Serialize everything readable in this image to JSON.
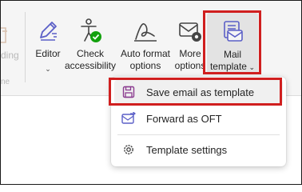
{
  "ribbon": {
    "partial_left_label": "ding",
    "partial_left_sub": "ne",
    "buttons": [
      {
        "label_line1": "Editor",
        "label_line2": "",
        "has_dropdown": true,
        "icon": "editor-pen-icon"
      },
      {
        "label_line1": "Check",
        "label_line2": "accessibility",
        "has_dropdown": false,
        "icon": "accessibility-check-icon"
      },
      {
        "label_line1": "Auto format",
        "label_line2": "options",
        "has_dropdown": false,
        "icon": "auto-format-icon"
      },
      {
        "label_line1": "More",
        "label_line2": "options",
        "has_dropdown": false,
        "icon": "mail-settings-icon"
      },
      {
        "label_line1": "Mail",
        "label_line2": "template",
        "has_dropdown": true,
        "icon": "mail-template-icon"
      }
    ]
  },
  "menu": {
    "items": [
      {
        "label": "Save email as template",
        "icon": "save-icon",
        "highlighted": true
      },
      {
        "label": "Forward as OFT",
        "icon": "forward-mail-icon",
        "highlighted": false
      },
      {
        "label": "Template settings",
        "icon": "gear-icon",
        "highlighted": false
      }
    ]
  },
  "colors": {
    "accent": "#5b5fc7",
    "highlight_box": "#d01f1f",
    "check_green": "#13a10e"
  }
}
